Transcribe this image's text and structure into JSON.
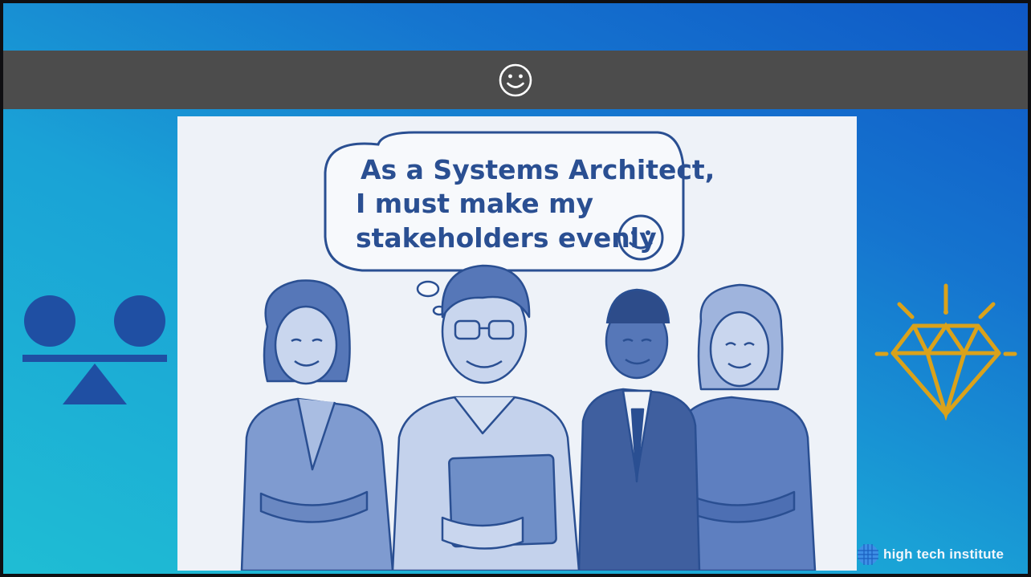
{
  "slide": {
    "title_icon": "smiley-face-icon",
    "illustration": {
      "speech_bubble": {
        "line1": "As a Systems Architect,",
        "line2": "I must make my",
        "line3": "stakeholders evenly"
      }
    },
    "left_icon": "balance-scale-icon",
    "right_icon": "diamond-sparkle-icon",
    "brand": {
      "name": "high tech institute"
    }
  },
  "colors": {
    "background_top": "#0f58c6",
    "background_bottom": "#1fbdd4",
    "title_bar": "#4c4c4c",
    "balance_icon": "#1f4fa3",
    "diamond_icon": "#d9a21b",
    "illustration_ink": "#2a4f92",
    "illustration_fill": "#6f8fc8"
  }
}
